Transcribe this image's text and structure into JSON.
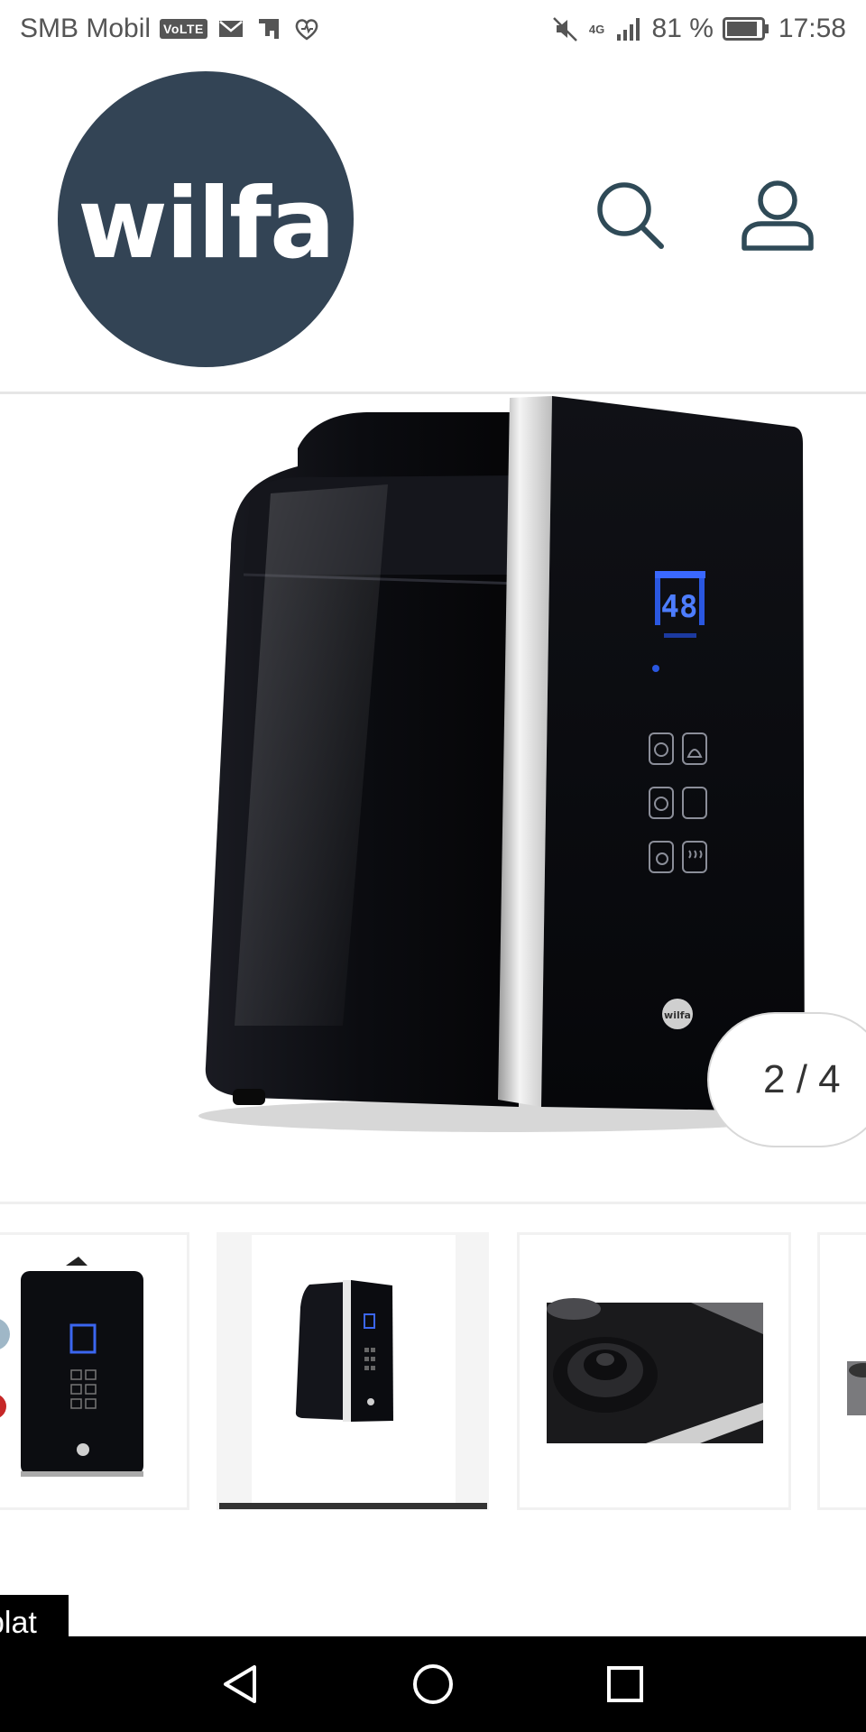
{
  "status_bar": {
    "carrier": "SMB Mobil",
    "volte": "VoLTE",
    "network": "4G",
    "battery": "81 %",
    "time": "17:58",
    "icons": [
      "mail-icon",
      "sim-toolkit-icon",
      "huawei-health-icon",
      "mute-icon",
      "signal-icon",
      "battery-icon"
    ]
  },
  "header": {
    "logo_text": "wilfa",
    "logo_color": "#334455",
    "icons": [
      "search-icon",
      "account-icon"
    ]
  },
  "gallery": {
    "counter": "2 / 4",
    "current_index": 2,
    "total": 4,
    "main_image": "product-humidifier-side-view",
    "display_reading": "48",
    "device_brand": "wilfa"
  },
  "thumbnails": [
    {
      "image": "humidifier-front-view"
    },
    {
      "image": "humidifier-side-view",
      "selected": true
    },
    {
      "image": "humidifier-top-knob-closeup"
    },
    {
      "image": "humidifier-detail"
    }
  ],
  "compare_tab": "plat",
  "nav_bar": {
    "icons": [
      "back-icon",
      "home-icon",
      "recent-apps-icon"
    ]
  }
}
